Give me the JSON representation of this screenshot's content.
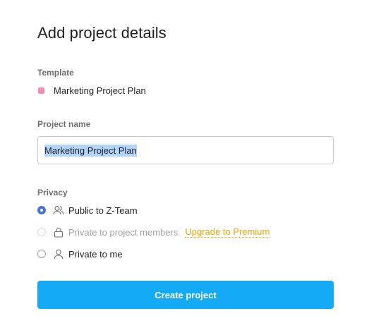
{
  "dialog": {
    "title": "Add project details"
  },
  "template": {
    "label": "Template",
    "name": "Marketing Project Plan",
    "color": "#f38fae"
  },
  "project_name": {
    "label": "Project name",
    "value": "Marketing Project Plan"
  },
  "privacy": {
    "label": "Privacy",
    "options": [
      {
        "label": "Public to Z-Team",
        "icon": "team-icon",
        "selected": true,
        "disabled": false
      },
      {
        "label": "Private to project members",
        "icon": "lock-icon",
        "selected": false,
        "disabled": true,
        "upsell": "Upgrade to Premium"
      },
      {
        "label": "Private to me",
        "icon": "person-icon",
        "selected": false,
        "disabled": false
      }
    ]
  },
  "actions": {
    "create_label": "Create project"
  },
  "colors": {
    "primary": "#14aaf5",
    "radio_selected": "#4573d2",
    "upgrade": "#e8a407"
  }
}
